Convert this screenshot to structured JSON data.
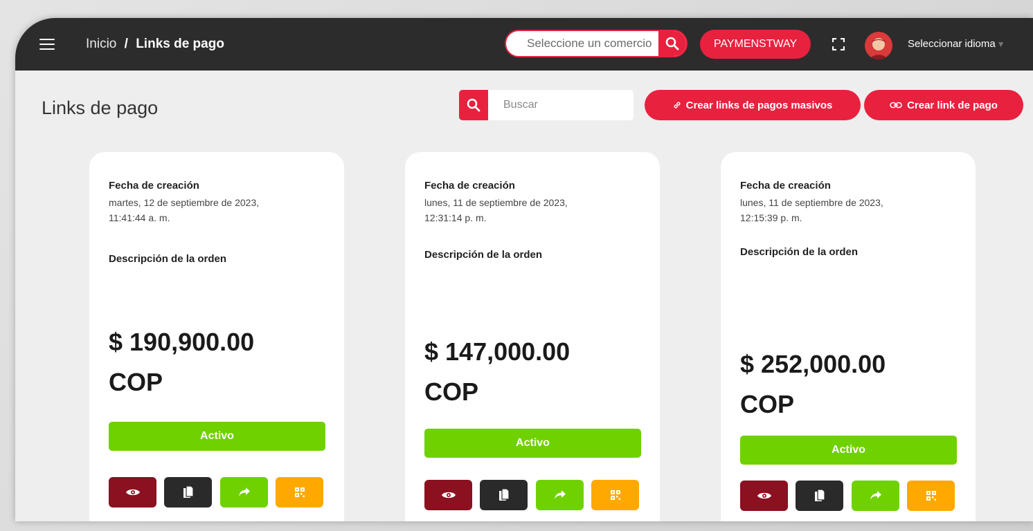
{
  "header": {
    "breadcrumb_home": "Inicio",
    "breadcrumb_separator": "/",
    "breadcrumb_current": "Links de pago",
    "merchant_placeholder": "Seleccione un comercio",
    "merchant_button": "PAYMENSTWAY",
    "language_label": "Seleccionar idioma",
    "language_caret": "▼"
  },
  "page": {
    "title": "Links de pago",
    "search_placeholder": "Buscar",
    "mass_button": "Crear links de pagos masivos",
    "single_button": "Crear link de pago"
  },
  "colors": {
    "accent": "#e8213f",
    "topbar": "#2c2c2c",
    "status_active": "#6fd100",
    "view_action": "#8b1020",
    "copy_action": "#2a2a2a",
    "share_action": "#6fd100",
    "qr_action": "#ffa800"
  },
  "icons": {
    "menu": "menu-icon",
    "search": "search-icon",
    "expand": "expand-icon",
    "avatar": "avatar",
    "link": "link-icon",
    "view": "eye-icon",
    "copy": "copy-icon",
    "share": "share-icon",
    "qr": "qr-code-icon"
  },
  "cards": [
    {
      "date_label": "Fecha de creación",
      "date_line1": "martes, 12 de septiembre de 2023,",
      "date_line2": "11:41:44 a. m.",
      "description_label": "Descripción de la orden",
      "amount": "$ 190,900.00",
      "currency": "COP",
      "status": "Activo"
    },
    {
      "date_label": "Fecha de creación",
      "date_line1": "lunes, 11 de septiembre de 2023,",
      "date_line2": "12:31:14 p. m.",
      "description_label": "Descripción de la orden",
      "amount": "$ 147,000.00",
      "currency": "COP",
      "status": "Activo"
    },
    {
      "date_label": "Fecha de creación",
      "date_line1": "lunes, 11 de septiembre de 2023,",
      "date_line2": "12:15:39 p. m.",
      "description_label": "Descripción de la orden",
      "amount": "$ 252,000.00",
      "currency": "COP",
      "status": "Activo"
    }
  ]
}
